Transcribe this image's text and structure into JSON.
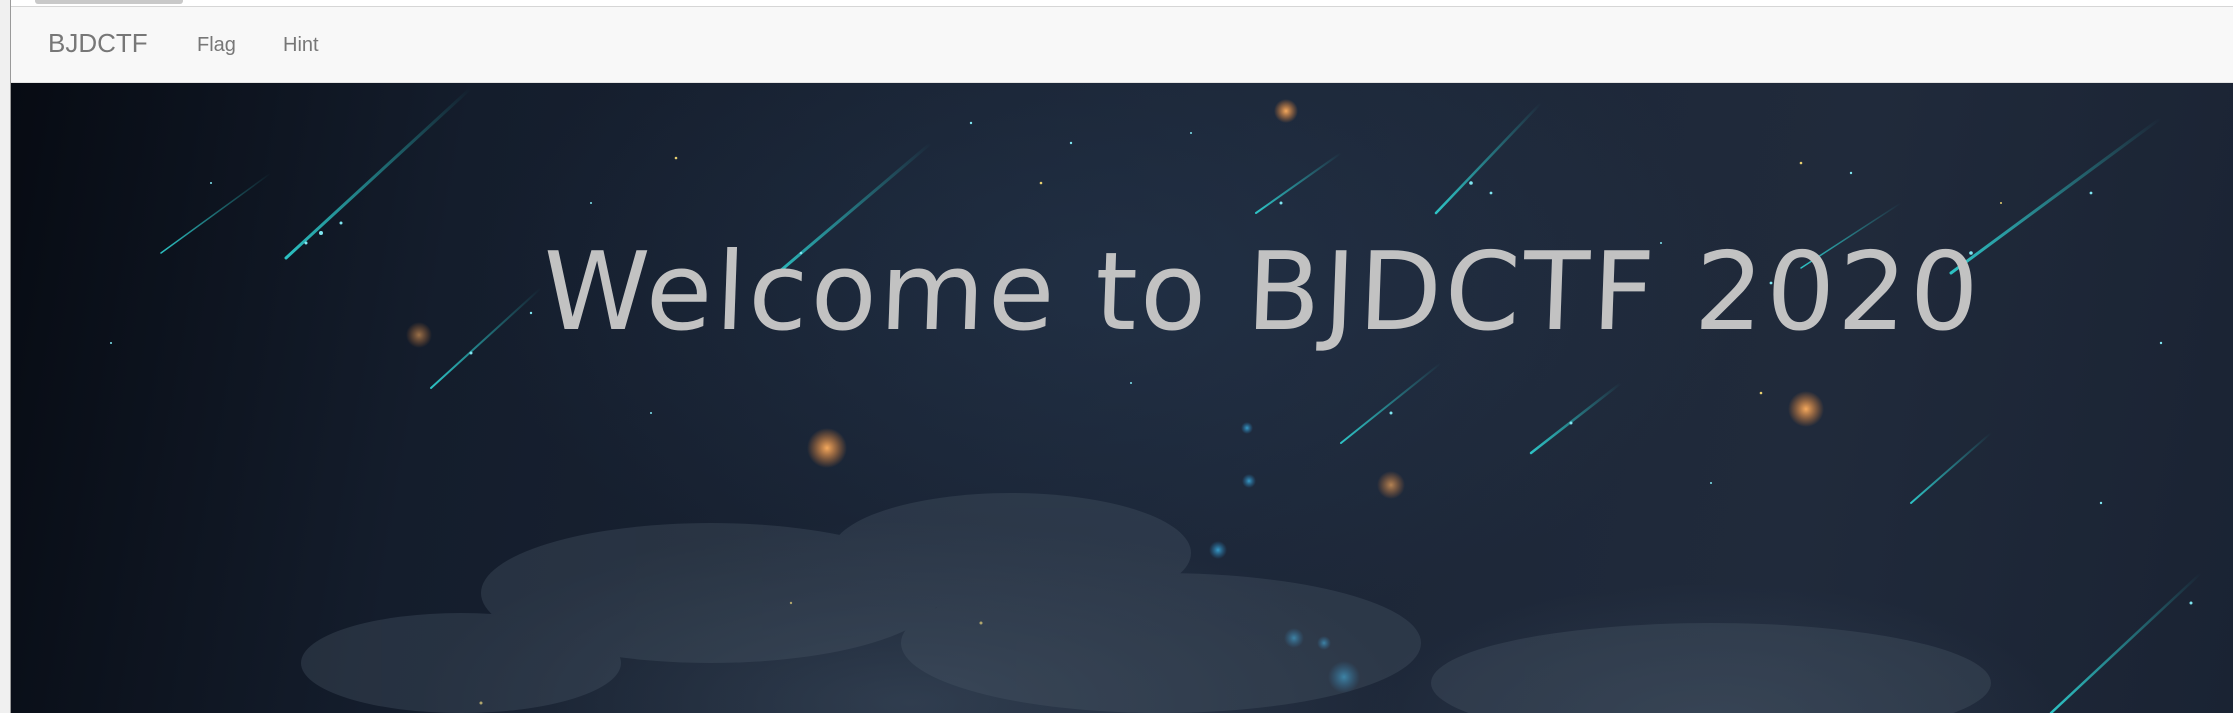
{
  "navbar": {
    "brand": "BJDCTF",
    "links": [
      {
        "label": "Flag"
      },
      {
        "label": "Hint"
      }
    ]
  },
  "hero": {
    "title": "Welcome to BJDCTF 2020",
    "colors": {
      "title": "#c2c2c2",
      "meteor": "#2fd4d4",
      "background": "#1c2637"
    }
  }
}
